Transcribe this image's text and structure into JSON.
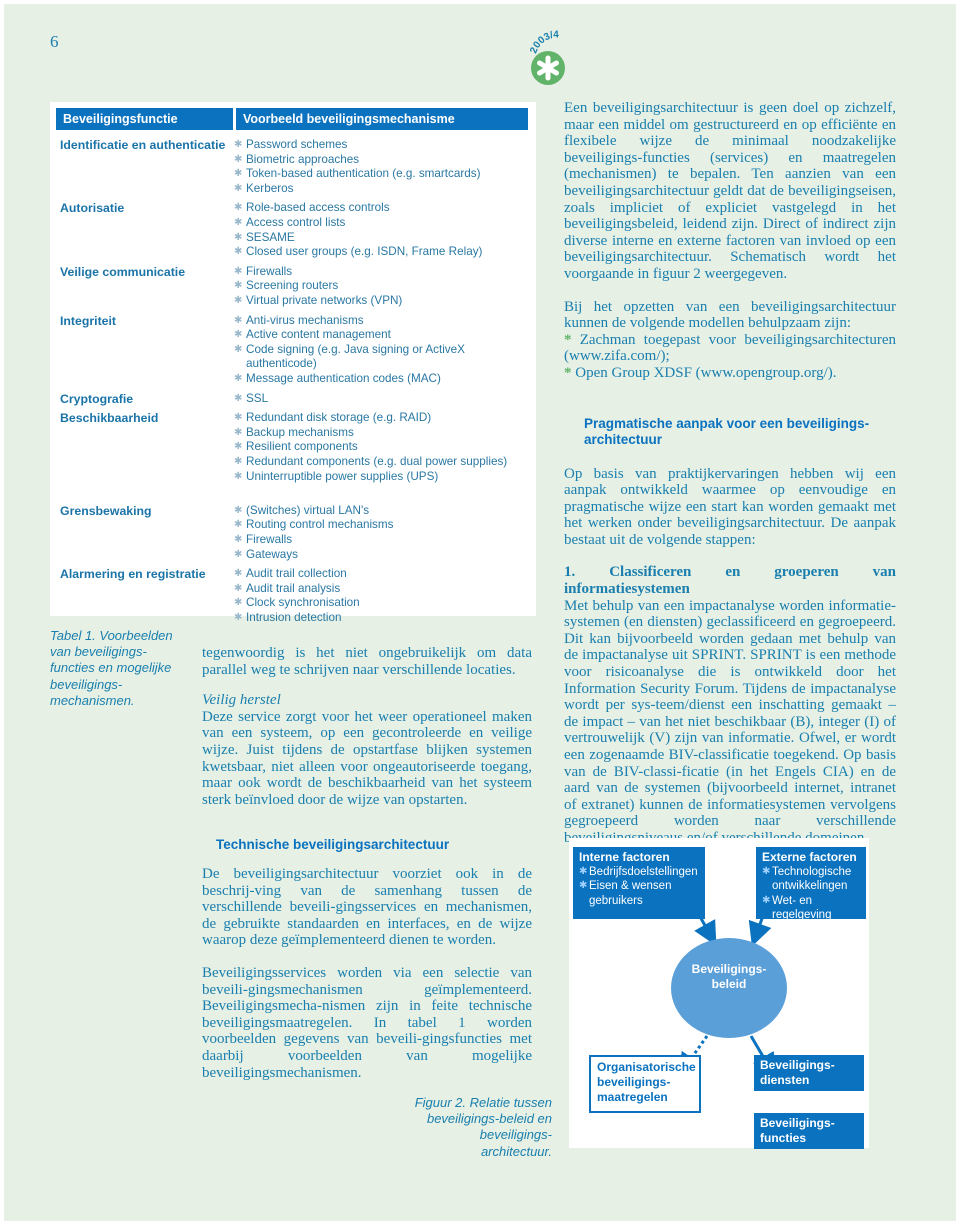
{
  "page": {
    "number": "6",
    "badge": {
      "issue": "2003/4",
      "icon": "asterisk-icon",
      "color": "#62b36a"
    }
  },
  "table": {
    "headers": [
      "Beveiligingsfunctie",
      "Voorbeeld beveiligingsmechanisme"
    ],
    "rows": [
      {
        "function": "Identificatie en authenticatie",
        "mechanisms": [
          "Password schemes",
          "Biometric approaches",
          "Token-based authentication (e.g. smartcards)",
          "Kerberos"
        ]
      },
      {
        "function": "Autorisatie",
        "mechanisms": [
          "Role-based access controls",
          "Access control lists",
          "SESAME",
          "Closed user groups (e.g. ISDN, Frame Relay)"
        ]
      },
      {
        "function": "Veilige communicatie",
        "mechanisms": [
          "Firewalls",
          "Screening routers",
          "Virtual private networks (VPN)"
        ]
      },
      {
        "function": "Integriteit",
        "mechanisms": [
          "Anti-virus mechanisms",
          "Active content management",
          "Code signing (e.g. Java signing or ActiveX authenticode)",
          "Message authentication codes (MAC)"
        ]
      },
      {
        "function": "Cryptografie",
        "mechanisms": [
          "SSL"
        ]
      },
      {
        "function": "Beschikbaarheid",
        "mechanisms": [
          "Redundant disk storage (e.g. RAID)",
          "Backup mechanisms",
          "Resilient components",
          "Redundant components (e.g. dual power supplies)",
          "Uninterruptible power supplies (UPS)"
        ]
      },
      {
        "function": "Grensbewaking",
        "mechanisms": [
          "(Switches) virtual LAN's",
          "Routing control mechanisms",
          "Firewalls",
          "Gateways"
        ]
      },
      {
        "function": "Alarmering en registratie",
        "mechanisms": [
          "Audit trail collection",
          "Audit trail analysis",
          "Clock synchronisation",
          "Intrusion detection"
        ]
      }
    ],
    "caption": "Tabel 1. Voorbeelden van beveiligings-functies en mogelijke beveiligings-mechanismen."
  },
  "middle_column": {
    "p1": "tegenwoordig is het niet ongebruikelijk om data parallel weg te schrijven naar verschillende locaties.",
    "subheading": "Veilig herstel",
    "p2": "Deze service zorgt voor het weer operationeel maken van een systeem, op een gecontroleerde en veilige wijze. Juist tijdens de opstartfase blijken systemen kwetsbaar, niet alleen voor ongeautoriseerde toegang, maar ook wordt de beschikbaarheid van het systeem sterk beïnvloed door de wijze van opstarten."
  },
  "right_column": {
    "p1": "Een beveiligingsarchitectuur is geen doel op zichzelf, maar een middel om gestructureerd en op efficiënte en flexibele wijze de minimaal noodzakelijke beveiligings-functies (services) en maatregelen (mechanismen) te bepalen. Ten aanzien van een beveiligingsarchitectuur geldt dat de beveiligingseisen, zoals impliciet of expliciet vastgelegd in het beveiligingsbeleid, leidend zijn. Direct of indirect zijn diverse interne en externe factoren van invloed op een beveiligingsarchitectuur. Schematisch wordt het voorgaande in figuur 2 weergegeven.",
    "p2": "Bij het opzetten van een beveiligingsarchitectuur kunnen de volgende modellen behulpzaam zijn:",
    "bullets": [
      "Zachman toegepast voor beveiligingsarchitecturen (www.zifa.com/);",
      "Open Group XDSF (www.opengroup.org/)."
    ],
    "heading": "Pragmatische aanpak voor een beveiligings-architectuur",
    "p3": "Op basis van praktijkervaringen hebben wij een aanpak ontwikkeld waarmee op eenvoudige en pragmatische wijze een start kan worden gemaakt met het werken onder beveiligingsarchitectuur. De aanpak bestaat uit de volgende stappen:",
    "step_title": "1. Classificeren en groeperen van informatiesystemen",
    "step_text": "Met behulp van een impactanalyse worden informatie-systemen (en diensten) geclassificeerd en gegroepeerd. Dit kan bijvoorbeeld worden gedaan met behulp van de impactanalyse uit SPRINT. SPRINT is een methode voor risicoanalyse die is ontwikkeld door het Information Security Forum. Tijdens de impactanalyse wordt per sys-teem/dienst een inschatting gemaakt – de impact – van het niet beschikbaar (B), integer (I) of vertrouwelijk (V) zijn van informatie. Ofwel, er wordt een zogenaamde BIV-classificatie toegekend. Op basis van de BIV-classi-ficatie (in het Engels CIA) en de aard van de systemen (bijvoorbeeld internet, intranet of extranet) kunnen de informatiesystemen vervolgens gegroepeerd worden naar verschillende beveiligingsniveaus en/of verschillende domeinen."
  },
  "bottom": {
    "heading": "Technische beveiligingsarchitectuur",
    "p1": "De beveiligingsarchitectuur voorziet ook in de beschrij-ving van de samenhang tussen de verschillende beveili-gingsservices en mechanismen, de gebruikte standaarden en interfaces, en de wijze waarop deze geïmplementeerd dienen te worden.",
    "p2": "Beveiligingsservices worden via een selectie van beveili-gingsmechanismen geïmplementeerd. Beveiligingsmecha-nismen zijn in feite technische beveiligingsmaatregelen. In tabel 1 worden voorbeelden gegevens van beveili-gingsfuncties met daarbij voorbeelden van mogelijke beveiligingsmechanismen.",
    "figure_caption": "Figuur 2. Relatie tussen beveiligings-beleid en beveiligings-architectuur."
  },
  "figure": {
    "internal": {
      "title": "Interne factoren",
      "items": [
        "Bedrijfsdoelstellingen",
        "Eisen & wensen gebruikers"
      ]
    },
    "external": {
      "title": "Externe factoren",
      "items": [
        "Technologische ontwikkelingen",
        "Wet- en regelgeving"
      ]
    },
    "policy": "Beveiligings-beleid",
    "organisational": "Organisatorische beveiligings-maatregelen",
    "services": "Beveiligings-diensten",
    "functions": "Beveiligings-functies"
  }
}
